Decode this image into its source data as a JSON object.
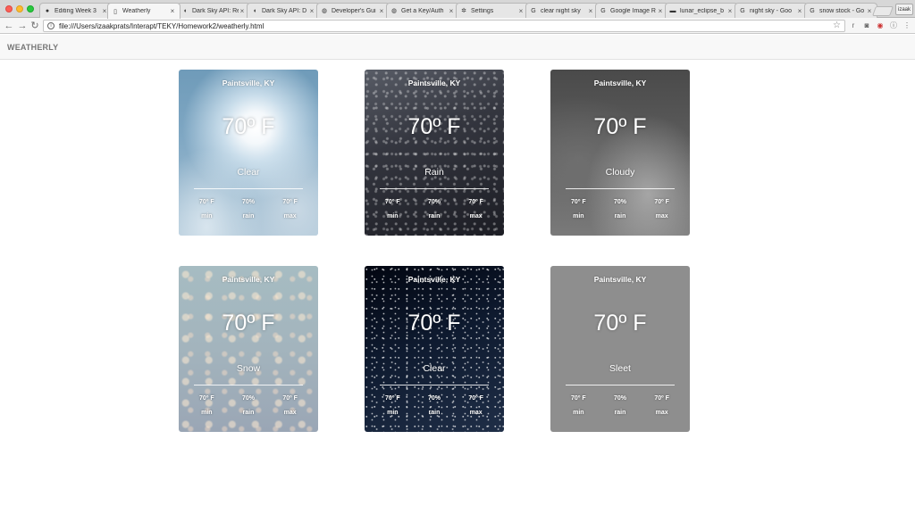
{
  "browser": {
    "tabs": [
      {
        "label": "Editing Week 3",
        "icon": "github-icon",
        "active": false
      },
      {
        "label": "Weatherly",
        "icon": "page-icon",
        "active": true
      },
      {
        "label": "Dark Sky API: Re",
        "icon": "darksky-icon",
        "active": false
      },
      {
        "label": "Dark Sky API: D",
        "icon": "darksky-icon",
        "active": false
      },
      {
        "label": "Developer's Gui",
        "icon": "globe-icon",
        "active": false
      },
      {
        "label": "Get a Key/Auth",
        "icon": "globe-icon",
        "active": false
      },
      {
        "label": "Settings",
        "icon": "gear-icon",
        "active": false
      },
      {
        "label": "clear night sky",
        "icon": "google-icon",
        "active": false
      },
      {
        "label": "Google Image R",
        "icon": "google-icon",
        "active": false
      },
      {
        "label": "lunar_eclipse_b",
        "icon": "image-icon",
        "active": false
      },
      {
        "label": "night sky - Goo",
        "icon": "google-icon",
        "active": false
      },
      {
        "label": "snow stock - Go",
        "icon": "google-icon",
        "active": false
      }
    ],
    "profile_label": "izaak",
    "address": "file:///Users/izaakprats/Interapt/TEKY/Homework2/weatherly.html"
  },
  "app": {
    "brand": "WEATHERLY"
  },
  "cards": [
    {
      "location": "Paintsville, KY",
      "temp": "70º F",
      "condition": "Clear",
      "min": "70º F",
      "rain": "70%",
      "max": "70º F",
      "min_label": "min",
      "rain_label": "rain",
      "max_label": "max",
      "theme": "clear-day"
    },
    {
      "location": "Paintsville, KY",
      "temp": "70º F",
      "condition": "Rain",
      "min": "70º F",
      "rain": "70%",
      "max": "70º F",
      "min_label": "min",
      "rain_label": "rain",
      "max_label": "max",
      "theme": "rain"
    },
    {
      "location": "Paintsville, KY",
      "temp": "70º F",
      "condition": "Cloudy",
      "min": "70º F",
      "rain": "70%",
      "max": "70º F",
      "min_label": "min",
      "rain_label": "rain",
      "max_label": "max",
      "theme": "cloudy"
    },
    {
      "location": "Paintsville, KY",
      "temp": "70º F",
      "condition": "Snow",
      "min": "70º F",
      "rain": "70%",
      "max": "70º F",
      "min_label": "min",
      "rain_label": "rain",
      "max_label": "max",
      "theme": "snow"
    },
    {
      "location": "Paintsville, KY",
      "temp": "70º F",
      "condition": "Clear",
      "min": "70º F",
      "rain": "70%",
      "max": "70º F",
      "min_label": "min",
      "rain_label": "rain",
      "max_label": "max",
      "theme": "clear-night"
    },
    {
      "location": "Paintsville, KY",
      "temp": "70º F",
      "condition": "Sleet",
      "min": "70º F",
      "rain": "70%",
      "max": "70º F",
      "min_label": "min",
      "rain_label": "rain",
      "max_label": "max",
      "theme": "sleet"
    }
  ]
}
